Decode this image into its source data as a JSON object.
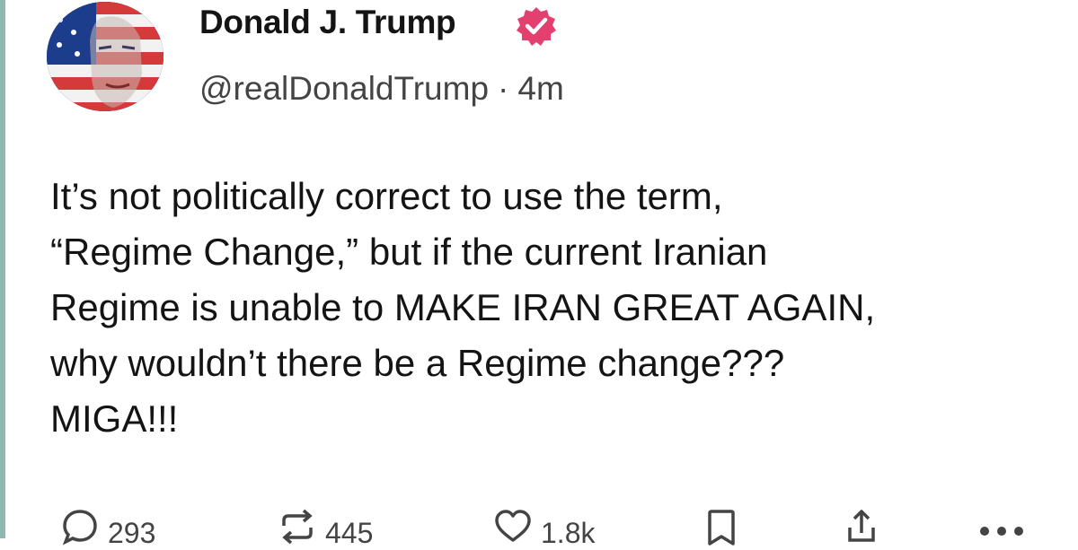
{
  "author": {
    "display_name": "Donald J. Trump",
    "handle": "@realDonaldTrump",
    "time_ago": "4m",
    "separator": "·",
    "avatar_icon": "flag-portrait-avatar",
    "verified_icon": "verified-badge-icon",
    "verified_color": "#e4406f"
  },
  "post": {
    "lines": [
      "It’s not politically correct to use the term,",
      "“Regime Change,” but if the current Iranian",
      "Regime is unable to MAKE IRAN GREAT AGAIN,",
      "why wouldn’t there be a Regime change???",
      "MIGA!!!"
    ]
  },
  "actions": {
    "reply": {
      "icon": "reply-icon",
      "count": "293"
    },
    "repost": {
      "icon": "repost-icon",
      "count": "445"
    },
    "like": {
      "icon": "heart-icon",
      "count": "1.8k"
    },
    "bookmark": {
      "icon": "bookmark-icon"
    },
    "share": {
      "icon": "share-icon"
    },
    "more": {
      "icon": "more-icon"
    }
  }
}
